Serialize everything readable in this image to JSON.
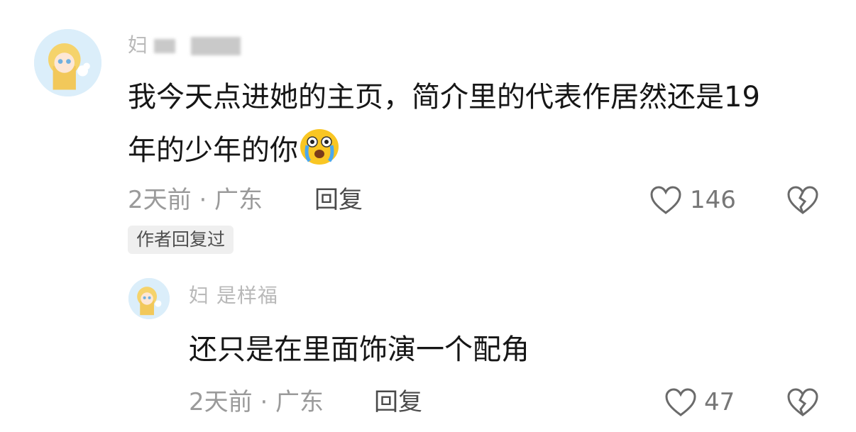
{
  "comment": {
    "username": "妇",
    "text_line1": "我今天点进她的主页，简介里的代表作居然还是19",
    "text_line2": "年的少年的你",
    "emoji": "crying-face",
    "time_location": "2天前 · 广东",
    "reply_label": "回复",
    "like_count": "146",
    "author_replied_tag": "作者回复过"
  },
  "reply": {
    "username": "妇 是样福",
    "text": "还只是在里面饰演一个配角",
    "time_location": "2天前 · 广东",
    "reply_label": "回复",
    "like_count": "47"
  },
  "colors": {
    "meta": "#9a9a9a",
    "tag_bg": "#efefef",
    "icon": "#6a6a6a"
  }
}
